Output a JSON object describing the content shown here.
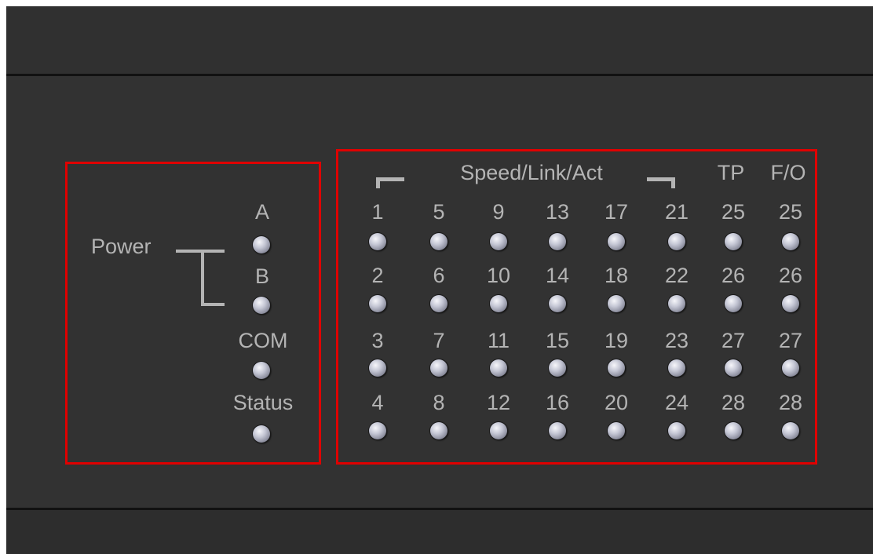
{
  "power_group": {
    "power_label": "Power",
    "a_label": "A",
    "b_label": "B",
    "com_label": "COM",
    "status_label": "Status"
  },
  "port_group": {
    "header_label": "Speed/Link/Act",
    "tp_label": "TP",
    "fo_label": "F/O",
    "columns": [
      [
        "1",
        "2",
        "3",
        "4"
      ],
      [
        "5",
        "6",
        "7",
        "8"
      ],
      [
        "9",
        "10",
        "11",
        "12"
      ],
      [
        "13",
        "14",
        "15",
        "16"
      ],
      [
        "17",
        "18",
        "19",
        "20"
      ],
      [
        "21",
        "22",
        "23",
        "24"
      ],
      [
        "25",
        "26",
        "27",
        "28"
      ],
      [
        "25",
        "26",
        "27",
        "28"
      ]
    ]
  },
  "colors": {
    "panel": "#323232",
    "label": "#b4b4b4",
    "highlight": "#e00000",
    "led": "#c4c6d4"
  }
}
